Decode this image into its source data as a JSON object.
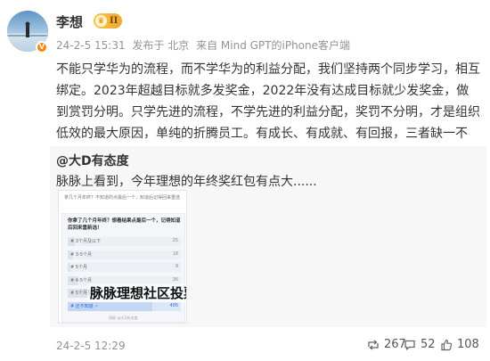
{
  "user": {
    "name": "李想",
    "rank_badge": "II",
    "verified_mark": "V"
  },
  "meta": {
    "date": "24-2-5 15:31",
    "location": "发布于 北京",
    "source": "来自 Mind GPT的iPhone客户端"
  },
  "post": {
    "text": "不能只学华为的流程，而不学华为的利益分配，我们坚持两个同步学习，相互绑定。2023年超越目标就多发奖金，2022年没有达成目标就少发奖金，做到赏罚分明。只学先进的流程，不学先进的利益分配，奖罚不分明，才是组织低效的最大原因，单纯的折腾员工。有成长、有成就、有回报，三者缺一不可。"
  },
  "repost": {
    "author": "@大D有态度",
    "text": "脉脉上看到，今年理想的年终奖红包有点大......",
    "image": {
      "question_outer": "拿几个月年终？不知道的点最后一个，知道后记得回来重选",
      "question_inner": "你拿了几个月年终？想看结果点最后一个，记得知道后回来重新选！",
      "watermark": "脉脉理想社区投票",
      "footer": "脉脉 @大D有态度",
      "options": [
        {
          "label": "# 3个月及以下",
          "count": "25",
          "ratio": 0.06,
          "selected": false
        },
        {
          "label": "# 3-5个月",
          "count": "18",
          "ratio": 0.04,
          "selected": false
        },
        {
          "label": "# 5个月",
          "count": "9",
          "ratio": 0.02,
          "selected": false
        },
        {
          "label": "# 4-5个月",
          "count": "36",
          "ratio": 0.09,
          "selected": false
        },
        {
          "label": "# 5个月及以上",
          "count": "97",
          "ratio": 0.24,
          "selected": false
        },
        {
          "label": "# 还不知道 ✓",
          "count": "405",
          "ratio": 0.75,
          "selected": true
        }
      ]
    }
  },
  "footer": {
    "time": "24-2-5 12:29",
    "reposts": "267",
    "comments": "52",
    "likes": "108"
  },
  "colors": {
    "meta_gray": "#939393",
    "badge_gold": "#f0a630",
    "verified_orange": "#ff8200",
    "selected_blue": "#2f6bd8"
  }
}
